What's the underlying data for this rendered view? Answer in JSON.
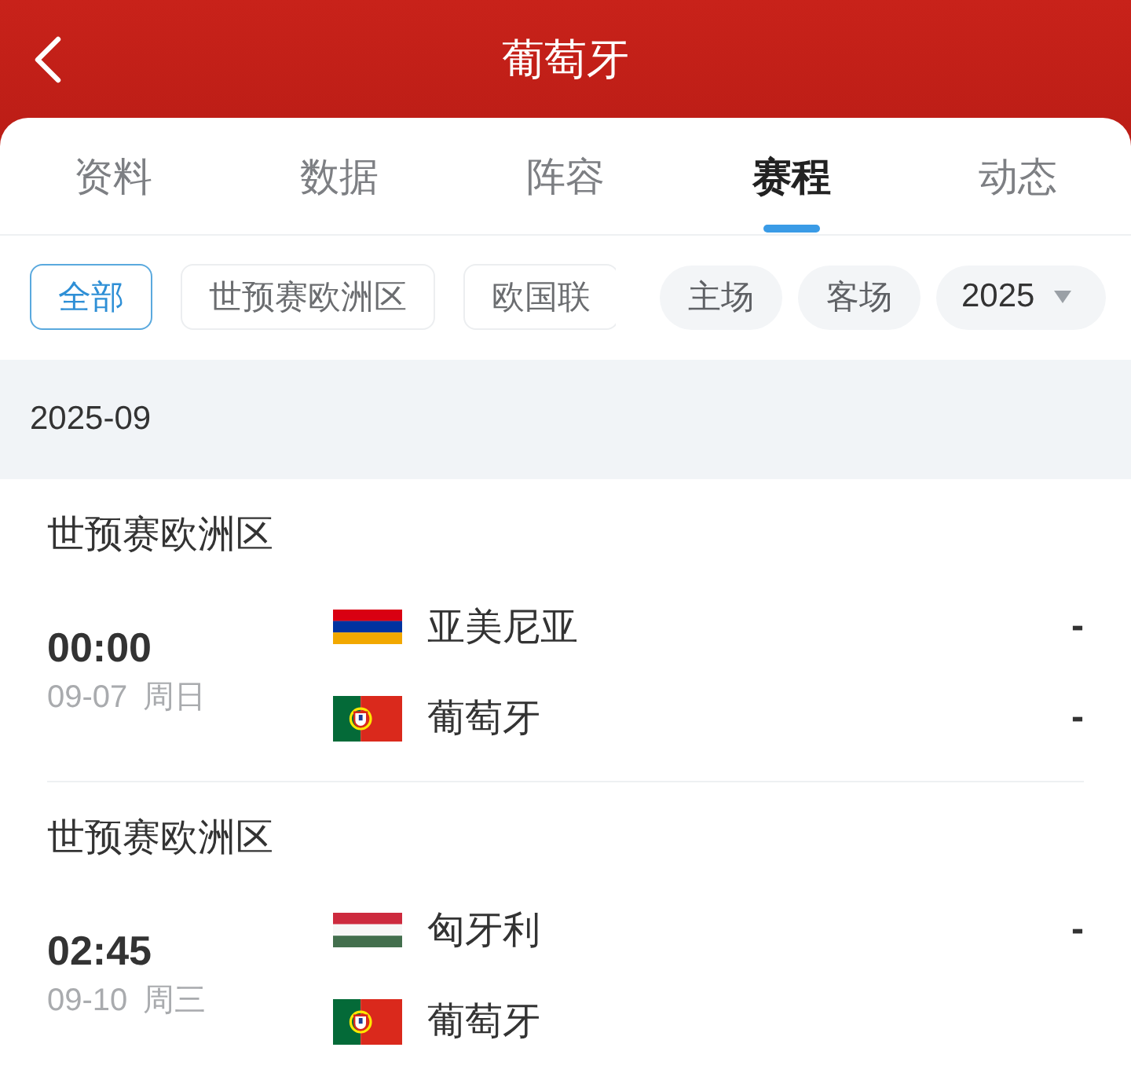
{
  "header": {
    "title": "葡萄牙"
  },
  "tabs": [
    {
      "label": "资料",
      "selected": false
    },
    {
      "label": "数据",
      "selected": false
    },
    {
      "label": "阵容",
      "selected": false
    },
    {
      "label": "赛程",
      "selected": true
    },
    {
      "label": "动态",
      "selected": false
    }
  ],
  "filters": {
    "leagues": [
      {
        "label": "全部",
        "selected": true
      },
      {
        "label": "世预赛欧洲区",
        "selected": false
      },
      {
        "label": "欧国联",
        "selected": false
      }
    ],
    "venues": [
      {
        "label": "主场",
        "selected": false
      },
      {
        "label": "客场",
        "selected": false
      }
    ],
    "year": {
      "value": "2025"
    }
  },
  "months": [
    {
      "label": "2025-09",
      "groups": [
        {
          "competition": "世预赛欧洲区",
          "time": "00:00",
          "date": "09-07",
          "weekday": "周日",
          "teams": [
            {
              "kind": "armenia",
              "name": "亚美尼亚",
              "score": "-"
            },
            {
              "kind": "portugal",
              "name": "葡萄牙",
              "score": "-"
            }
          ]
        },
        {
          "competition": "世预赛欧洲区",
          "time": "02:45",
          "date": "09-10",
          "weekday": "周三",
          "teams": [
            {
              "kind": "hungary",
              "name": "匈牙利",
              "score": "-"
            },
            {
              "kind": "portugal",
              "name": "葡萄牙"
            }
          ]
        }
      ]
    }
  ]
}
